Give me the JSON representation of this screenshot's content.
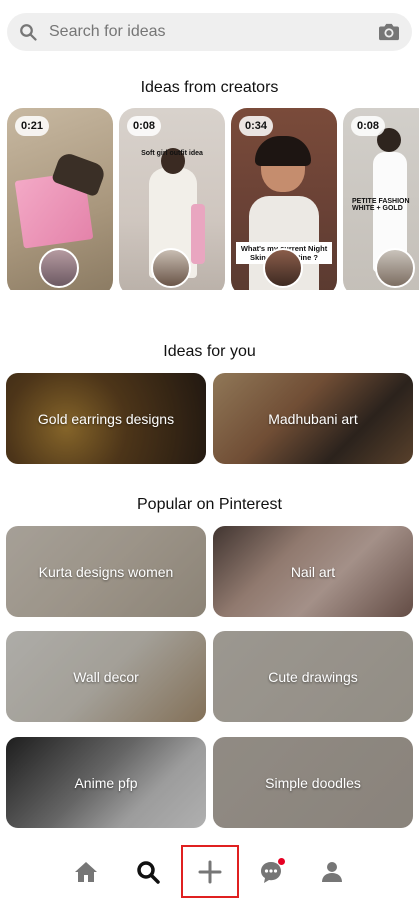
{
  "search": {
    "placeholder": "Search for ideas"
  },
  "sections": {
    "creators_title": "Ideas from creators",
    "for_you_title": "Ideas for you",
    "popular_title": "Popular on Pinterest"
  },
  "creator_pins": [
    {
      "duration": "0:21",
      "overlay": ""
    },
    {
      "duration": "0:08",
      "overlay": "Soft girl outfit idea"
    },
    {
      "duration": "0:34",
      "overlay": "What's my current Night Skincare Routine ?"
    },
    {
      "duration": "0:08",
      "overlay": "PETITE FASHION WHITE + GOLD"
    }
  ],
  "ideas_for_you": [
    {
      "label": "Gold earrings designs"
    },
    {
      "label": "Madhubani art"
    }
  ],
  "popular": [
    {
      "label": "Kurta designs women"
    },
    {
      "label": "Nail art"
    },
    {
      "label": "Wall decor"
    },
    {
      "label": "Cute drawings"
    },
    {
      "label": "Anime pfp"
    },
    {
      "label": "Simple doodles"
    }
  ],
  "nav": {
    "items": [
      "home-icon",
      "search-icon",
      "plus-icon",
      "messages-icon",
      "profile-icon"
    ],
    "notification_color": "#e60023"
  }
}
